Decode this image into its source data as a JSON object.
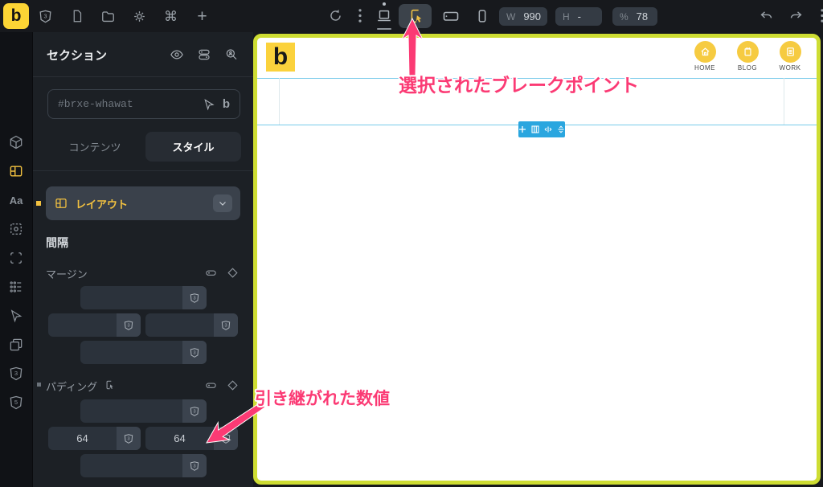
{
  "toolbar": {
    "logo": "b",
    "dimensions": {
      "w_label": "W",
      "w_value": "990",
      "h_label": "H",
      "h_value": "-",
      "pct_label": "%",
      "pct_value": "78"
    }
  },
  "panel": {
    "title": "セクション",
    "id_placeholder": "#brxe-whawat",
    "id_brand": "b",
    "tabs": {
      "content": "コンテンツ",
      "style": "スタイル"
    },
    "accordion_layout": "レイアウト",
    "spacing_heading": "間隔",
    "margin": {
      "label": "マージン",
      "top": "",
      "right": "",
      "bottom": "",
      "left": ""
    },
    "padding": {
      "label": "パディング",
      "top": "",
      "right": "64",
      "bottom": "",
      "left": "64"
    }
  },
  "glyphs": {
    "command": "⌘",
    "plus": "+",
    "typography": "Aa",
    "css_badge": "3",
    "html_badge": "5"
  },
  "canvas": {
    "logo": "b",
    "nav": [
      {
        "label": "HOME"
      },
      {
        "label": "BLOG"
      },
      {
        "label": "WORK"
      }
    ]
  },
  "annotations": {
    "breakpoint": "選択されたブレークポイント",
    "inherited": "引き継がれた数値"
  },
  "colors": {
    "accent_yellow": "#fcd535",
    "viewport_lime": "#cedd33",
    "selection_blue": "#79cbea",
    "element_toolbar_blue": "#2aa6df",
    "annotation_pink": "#fb3a74"
  }
}
